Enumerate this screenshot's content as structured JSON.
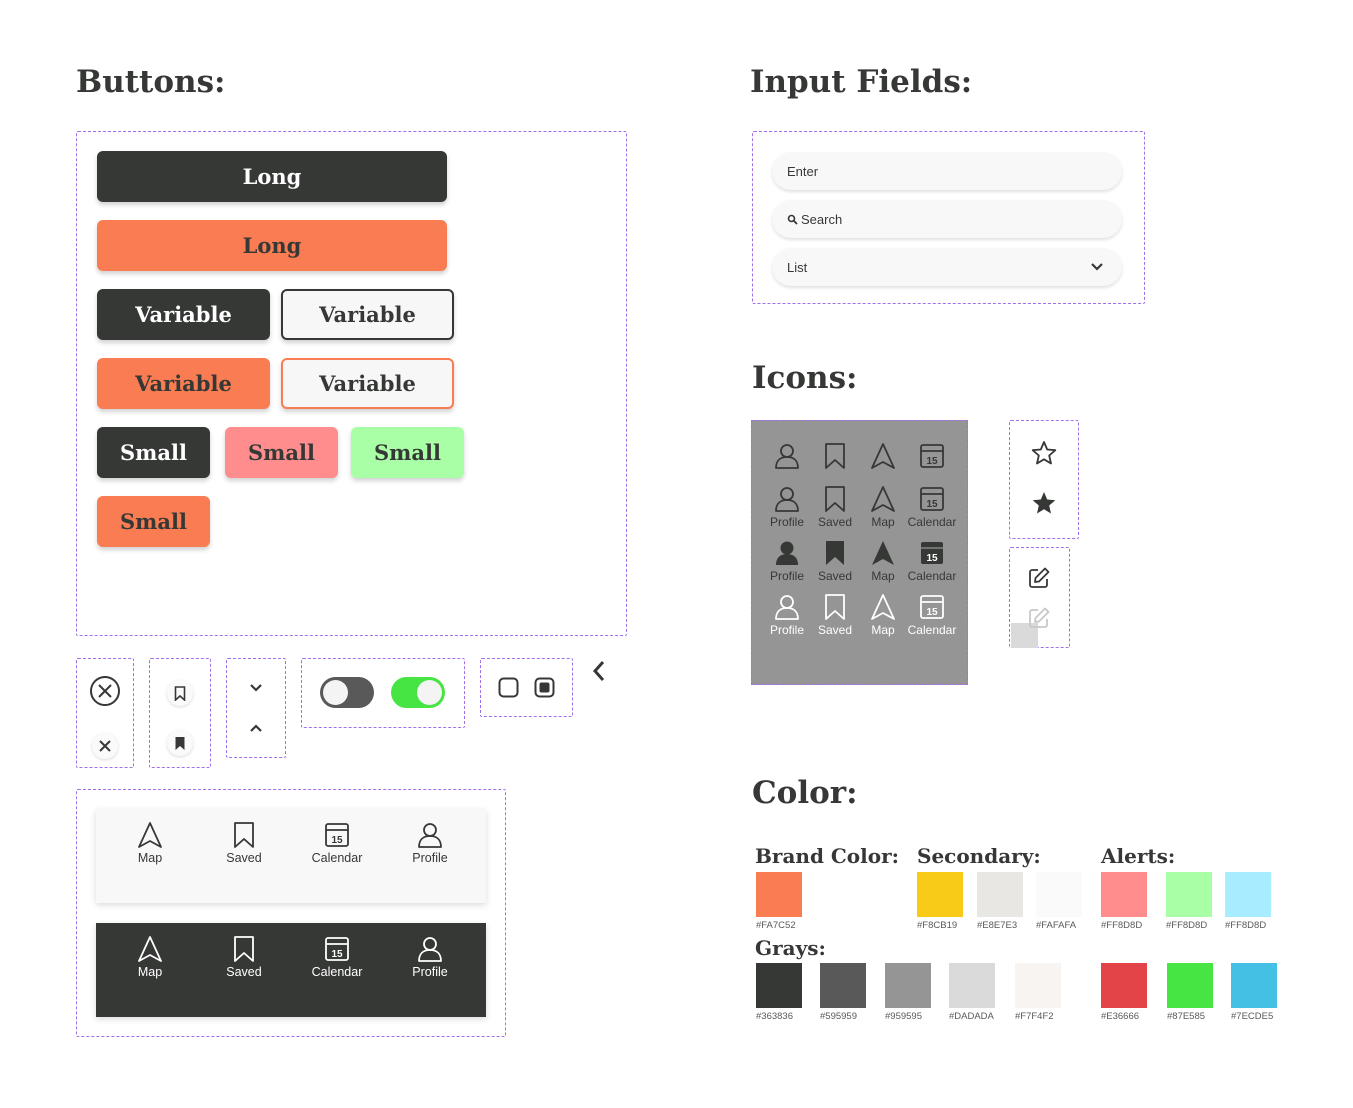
{
  "sections": {
    "buttons": "Buttons:",
    "input_fields": "Input Fields:",
    "icons": "Icons:",
    "color": "Color:"
  },
  "buttons": {
    "long_dark": "Long",
    "long_brand": "Long",
    "variable_dark": "Variable",
    "variable_outline_dark": "Variable",
    "variable_brand": "Variable",
    "variable_outline_brand": "Variable",
    "small_dark": "Small",
    "small_pink": "Small",
    "small_mint": "Small",
    "small_brand": "Small"
  },
  "inputs": {
    "enter_placeholder": "Enter",
    "search_placeholder": "Search",
    "list_value": "List"
  },
  "icon_grid": {
    "labels": [
      "Profile",
      "Saved",
      "Map",
      "Calendar"
    ],
    "calendar_day": "15"
  },
  "nav_bar": {
    "items": [
      "Map",
      "Saved",
      "Calendar",
      "Profile"
    ],
    "calendar_day": "15"
  },
  "toggles": [
    {
      "state": "off"
    },
    {
      "state": "on"
    }
  ],
  "colors": {
    "brand_label": "Brand Color:",
    "secondary_label": "Secondary:",
    "alerts_label": "Alerts:",
    "grays_label": "Grays:",
    "brand": [
      {
        "hex": "#FA7C52",
        "label": "#FA7C52"
      }
    ],
    "secondary": [
      {
        "hex": "#F8CB19",
        "label": "#F8CB19"
      },
      {
        "hex": "#E8E7E3",
        "label": "#E8E7E3"
      },
      {
        "hex": "#FAFAFA",
        "label": "#FAFAFA"
      }
    ],
    "alerts_light": [
      {
        "hex": "#FF8D8D",
        "label": "#FF8D8D"
      },
      {
        "hex": "#A9FFA6",
        "label": "#FF8D8D"
      },
      {
        "hex": "#A8ECFF",
        "label": "#FF8D8D"
      }
    ],
    "grays": [
      {
        "hex": "#363836",
        "label": "#363836"
      },
      {
        "hex": "#595959",
        "label": "#595959"
      },
      {
        "hex": "#959595",
        "label": "#959595"
      },
      {
        "hex": "#DADADA",
        "label": "#DADADA"
      },
      {
        "hex": "#F7F4F2",
        "label": "#F7F4F2"
      }
    ],
    "alerts_dark": [
      {
        "hex": "#E34447",
        "label": "#E36666"
      },
      {
        "hex": "#46E544",
        "label": "#87E585"
      },
      {
        "hex": "#45C0E5",
        "label": "#7ECDE5"
      }
    ],
    "accent_purple": "#a070e8",
    "icon_panel_bg": "#959595"
  }
}
